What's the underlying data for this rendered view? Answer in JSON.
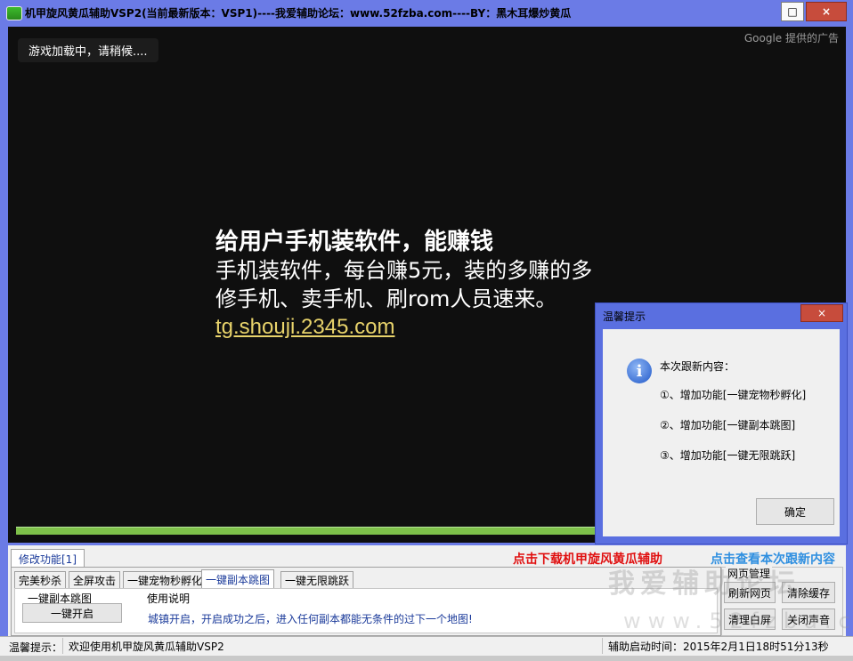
{
  "window": {
    "title": "机甲旋风黄瓜辅助VSP2(当前最新版本：VSP1)----我爱辅助论坛：www.52fzba.com----BY：黑木耳爆炒黄瓜",
    "max_label": "□",
    "close_label": "×"
  },
  "game": {
    "loading_text": "游戏加载中，请稍候....",
    "google_label": "Google 提供的广告",
    "ad": {
      "headline": "给用户手机装软件，能赚钱",
      "line1": "手机装软件，每台赚5元，装的多赚的多",
      "line2": "修手机、卖手机、刷rom人员速来。",
      "link": "tg.shouji.2345.com"
    }
  },
  "dialog": {
    "title": "温馨提示",
    "close_label": "×",
    "header": "本次跟新内容：",
    "items": [
      "①、增加功能[一键宠物秒孵化]",
      "②、增加功能[一键副本跳图]",
      "③、增加功能[一键无限跳跃]"
    ],
    "ok_label": "确定"
  },
  "panel": {
    "outer_tab": "修改功能[1]",
    "download_link": "点击下载机甲旋风黄瓜辅助",
    "changelog_link": "点击查看本次跟新内容",
    "tabs": [
      "完美秒杀",
      "全屏攻击",
      "一键宠物秒孵化",
      "一键副本跳图",
      "一键无限跳跃"
    ],
    "selected_tab": "一键副本跳图",
    "group_label": "一键副本跳图",
    "enable_button": "一键开启",
    "usage_label": "使用说明",
    "usage_text": "城镇开启，开启成功之后，进入任何副本都能无条件的过下一个地图!",
    "web_group_label": "网页管理",
    "buttons": {
      "refresh": "刷新网页",
      "clear_cache": "清除缓存",
      "clear_white": "清理白屏",
      "mute": "关闭声音"
    }
  },
  "watermark": {
    "line1": "我爱辅助论坛",
    "line2": "www.52fzba.com"
  },
  "status": {
    "label": "温馨提示：",
    "message": "欢迎使用机甲旋风黄瓜辅助VSP2",
    "time": "辅助启动时间：2015年2月1日18时51分13秒"
  },
  "colors": {
    "frame": "#6b7be6",
    "download_link": "#e01010",
    "changelog_link": "#2f8fe0",
    "progress": "#7ec14a"
  }
}
